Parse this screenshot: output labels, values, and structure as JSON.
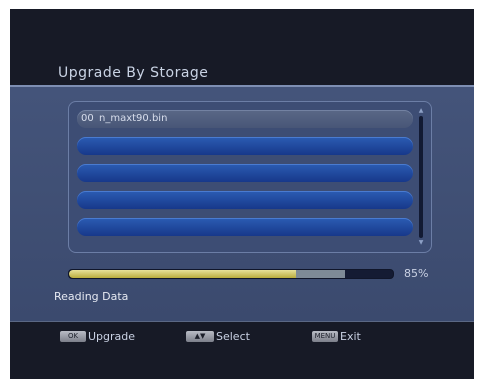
{
  "screen": {
    "title": "Upgrade By Storage"
  },
  "file_list": {
    "rows": [
      {
        "number": "00",
        "name": "n_maxt90.bin",
        "selected": true
      },
      {
        "number": "",
        "name": "",
        "selected": false
      },
      {
        "number": "",
        "name": "",
        "selected": false
      },
      {
        "number": "",
        "name": "",
        "selected": false
      },
      {
        "number": "",
        "name": "",
        "selected": false
      }
    ]
  },
  "progress": {
    "percent_label": "85%",
    "fraction_filled": 0.7,
    "fraction_buffered": 0.85,
    "status": "Reading Data"
  },
  "footer": {
    "hints": [
      {
        "key": "OK",
        "label": "Upgrade",
        "icon": "ok-key-icon"
      },
      {
        "key": "▲▼",
        "label": "Select",
        "icon": "up-down-key-icon"
      },
      {
        "key": "MENU",
        "label": "Exit",
        "icon": "menu-key-icon"
      }
    ]
  },
  "colors": {
    "progress_fill": "#d6cc6a",
    "row_blue": "#1f47a0",
    "panel": "#40507a"
  }
}
